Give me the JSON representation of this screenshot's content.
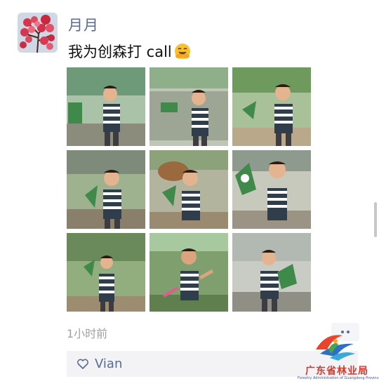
{
  "post": {
    "author": "月月",
    "text": "我为创森打 call",
    "emoji": "smiling-face-with-hand-icon",
    "timestamp": "1小时前",
    "photo_count": 9
  },
  "likes": {
    "names": "Vian"
  },
  "watermark": {
    "title": "广东省林业局",
    "subtitle": "Forestry Administration of Guangdong Province"
  },
  "colors": {
    "name_link": "#576b95",
    "likes_bg": "#f3f3f5",
    "watermark_red": "#d13a2f",
    "flag_green": "#3f8a4a"
  }
}
